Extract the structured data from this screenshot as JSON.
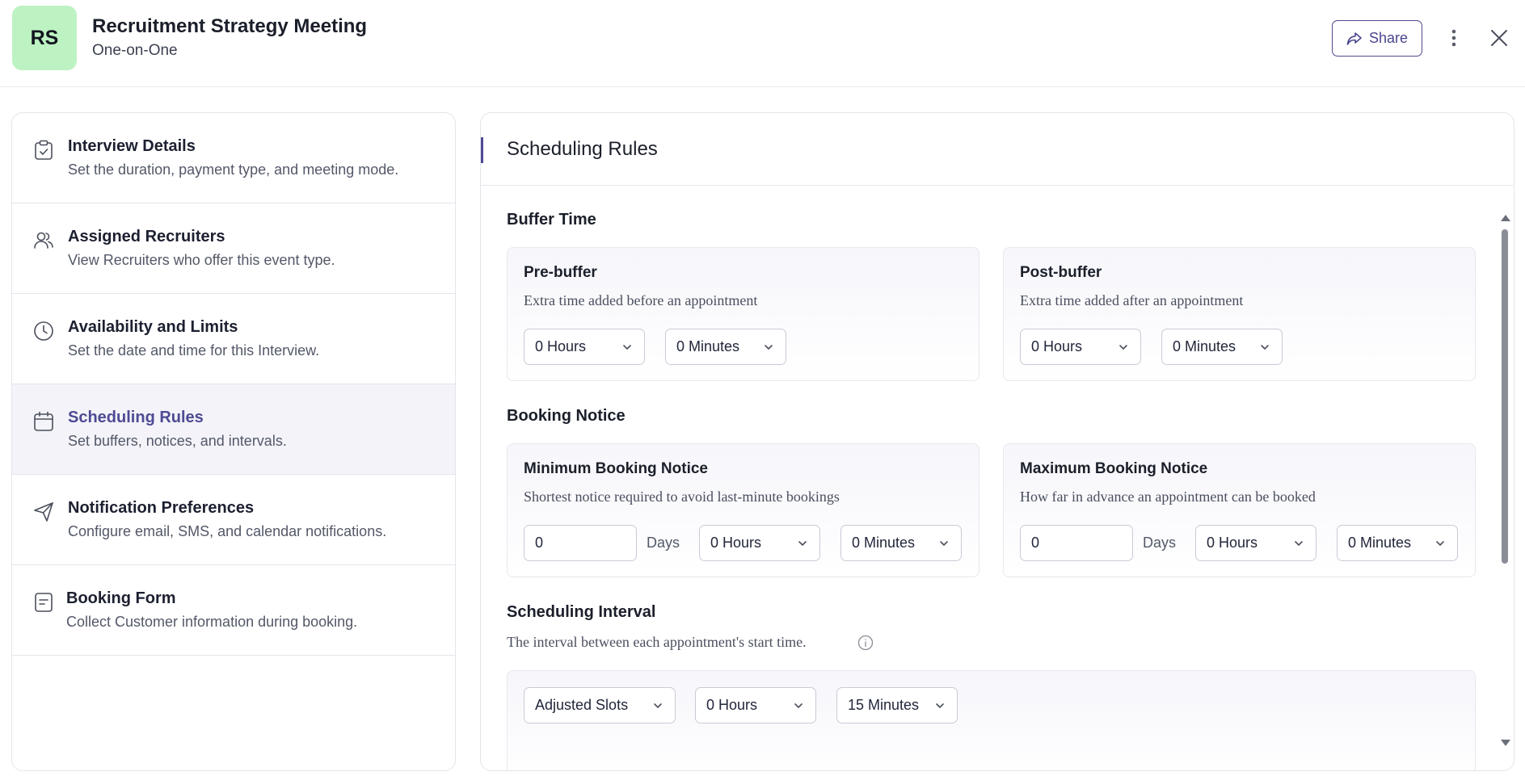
{
  "header": {
    "avatar_initials": "RS",
    "title": "Recruitment Strategy Meeting",
    "subtitle": "One-on-One",
    "share_label": "Share",
    "accent_color": "#4e4a93",
    "avatar_color": "#bdf2c2"
  },
  "sidebar": {
    "items": [
      {
        "title": "Interview Details",
        "desc": "Set the duration, payment type, and meeting mode.",
        "icon": "clipboard-check-icon"
      },
      {
        "title": "Assigned Recruiters",
        "desc": "View Recruiters who offer this event type.",
        "icon": "users-icon"
      },
      {
        "title": "Availability and Limits",
        "desc": "Set the date and time for this Interview.",
        "icon": "clock-icon"
      },
      {
        "title": "Scheduling Rules",
        "desc": "Set buffers, notices, and intervals.",
        "icon": "calendar-icon",
        "active": true
      },
      {
        "title": "Notification Preferences",
        "desc": "Configure email, SMS, and calendar notifications.",
        "icon": "send-icon"
      },
      {
        "title": "Booking Form",
        "desc": "Collect Customer information during booking.",
        "icon": "form-icon"
      }
    ]
  },
  "main": {
    "title": "Scheduling Rules",
    "buffer": {
      "section_title": "Buffer Time",
      "pre": {
        "title": "Pre-buffer",
        "desc": "Extra time added before an appointment",
        "hours": "0 Hours",
        "minutes": "0 Minutes"
      },
      "post": {
        "title": "Post-buffer",
        "desc": "Extra time added after an appointment",
        "hours": "0 Hours",
        "minutes": "0 Minutes"
      }
    },
    "notice": {
      "section_title": "Booking Notice",
      "min": {
        "title": "Minimum Booking Notice",
        "desc": "Shortest notice required to avoid last-minute bookings",
        "days": "0",
        "days_label": "Days",
        "hours": "0 Hours",
        "minutes": "0 Minutes"
      },
      "max": {
        "title": "Maximum Booking Notice",
        "desc": "How far in advance an appointment can be booked",
        "days": "0",
        "days_label": "Days",
        "hours": "0 Hours",
        "minutes": "0 Minutes"
      }
    },
    "interval": {
      "section_title": "Scheduling Interval",
      "desc": "The interval between each appointment's start time.",
      "slot_type": "Adjusted Slots",
      "hours": "0 Hours",
      "minutes": "15 Minutes"
    }
  }
}
